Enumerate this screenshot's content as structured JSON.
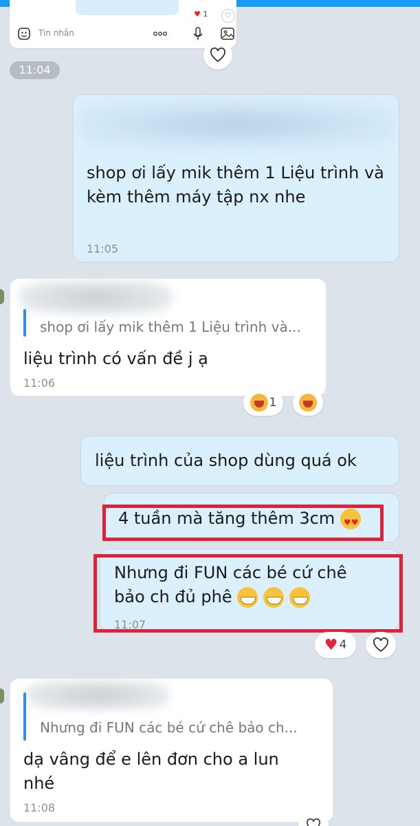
{
  "composer": {
    "placeholder": "Tin nhắn",
    "prev_reaction_count": "1"
  },
  "time_separator": "11:04",
  "messages": [
    {
      "id": "m1",
      "side": "me",
      "text": "shop ơi lấy mik thêm 1 Liệu trình và kèm thêm máy tập nx nhe",
      "time": "11:05"
    },
    {
      "id": "m2",
      "side": "them",
      "quote": "shop ơi lấy mik thêm 1 Liệu trình và...",
      "text": "liệu trình có vấn đề j ạ",
      "time": "11:06",
      "reaction_count": "1"
    },
    {
      "id": "m3",
      "side": "me",
      "text": "liệu trình của shop dùng quá ok"
    },
    {
      "id": "m4",
      "side": "me",
      "text": "4 tuần mà tăng thêm 3cm"
    },
    {
      "id": "m5",
      "side": "me",
      "text": "Nhưng đi FUN các bé cứ chê bảo ch đủ phê",
      "time": "11:07",
      "reaction_count": "4"
    },
    {
      "id": "m6",
      "side": "them",
      "quote": "Nhưng đi FUN các bé cứ chê bảo ch...",
      "text": "dạ vâng để e lên đơn cho a lun nhé",
      "time": "11:08"
    }
  ],
  "colors": {
    "background": "#dde3ea",
    "my_bubble": "#dbf0fd",
    "their_bubble": "#ffffff",
    "highlight_box": "#e0213a",
    "quote_bar": "#2d8ef0",
    "accent_top": "#1a9bf5"
  },
  "icons": [
    "sticker-icon",
    "more-icon",
    "mic-icon",
    "image-icon",
    "heart-icon",
    "laugh-emoji-icon",
    "heart-eyes-emoji-icon",
    "grin-emoji-icon",
    "red-heart-icon"
  ]
}
